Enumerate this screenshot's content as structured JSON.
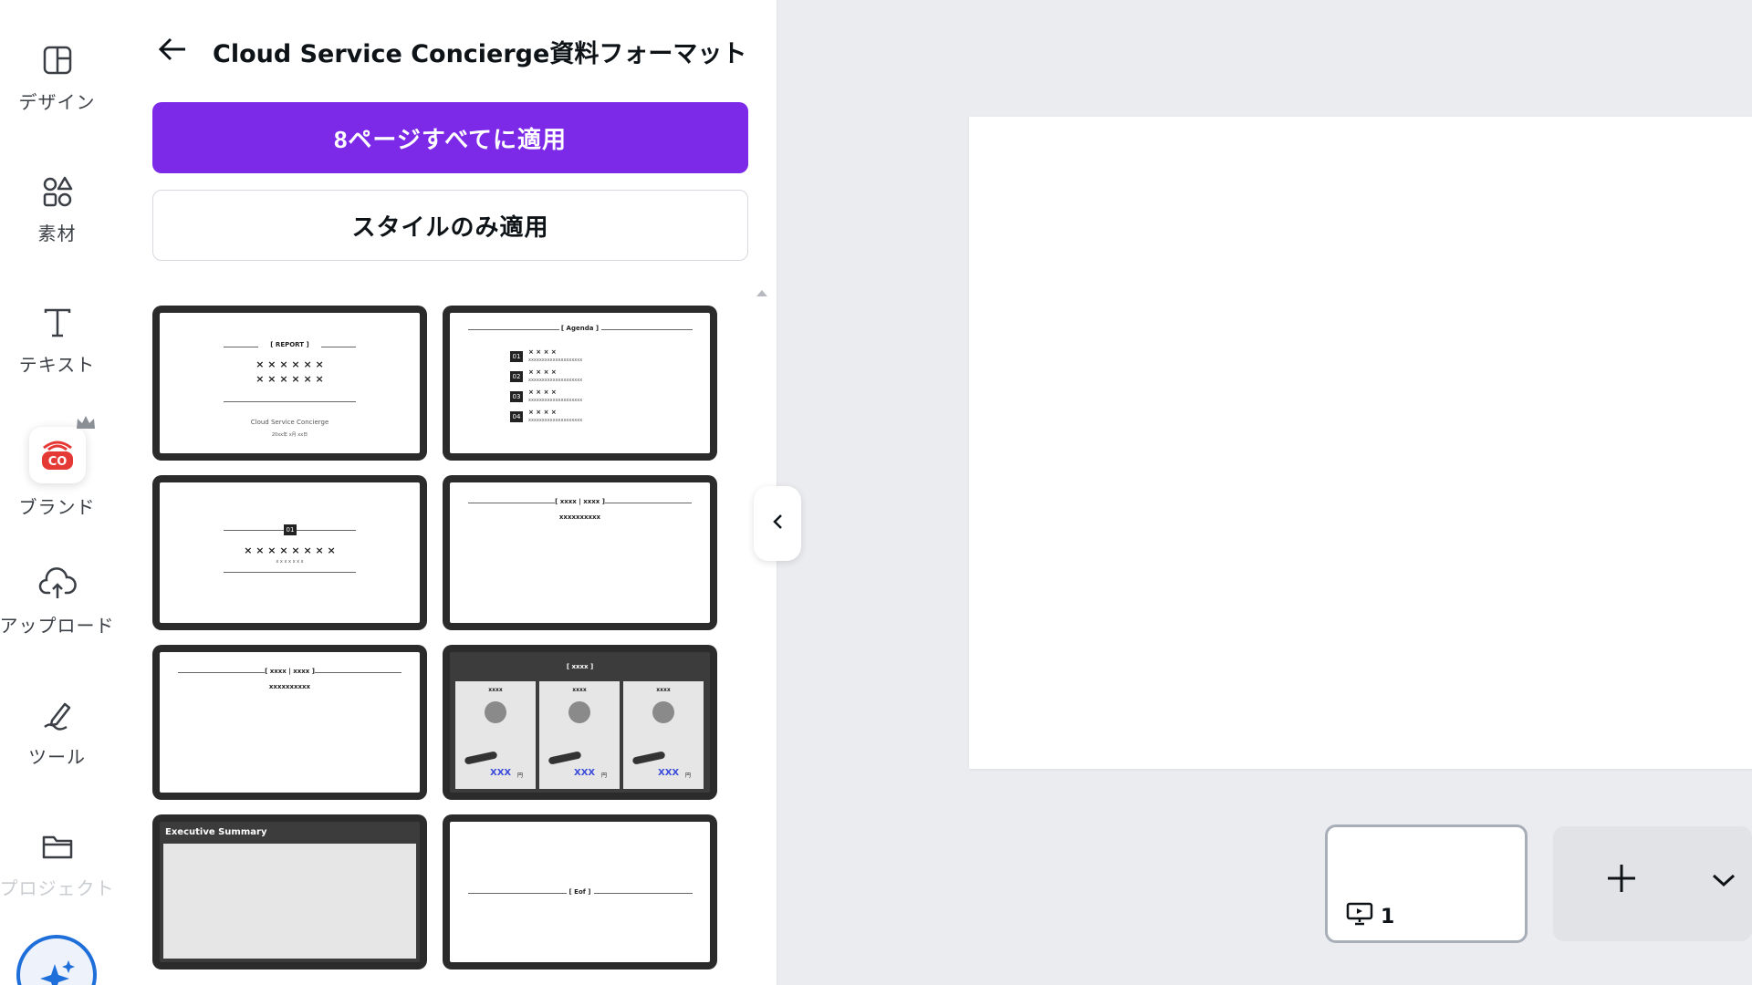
{
  "rail": {
    "items": [
      {
        "label": "デザイン",
        "icon": "layout-icon"
      },
      {
        "label": "素材",
        "icon": "shapes-icon"
      },
      {
        "label": "テキスト",
        "icon": "text-icon"
      },
      {
        "label": "ブランド",
        "icon": "brand-icon",
        "badge": "CO"
      },
      {
        "label": "アップロード",
        "icon": "cloud-upload-icon"
      },
      {
        "label": "ツール",
        "icon": "pen-tool-icon"
      },
      {
        "label": "プロジェクト",
        "icon": "folder-icon"
      }
    ]
  },
  "panel": {
    "title": "Cloud Service Concierge資料フォーマット",
    "apply_all": "8ページすべてに適用",
    "apply_style": "スタイルのみ適用",
    "thumbs": [
      {
        "heading": "[ REPORT ]",
        "line1": "× × × × × ×",
        "line2": "× × × × × ×",
        "logo": "Cloud Service Concierge",
        "date": "20xx年 x月 xx日"
      },
      {
        "heading": "[ Agenda ]",
        "items": [
          {
            "num": "01",
            "title": "× × × ×",
            "sub": "xxxxxxxxxxxxxxxxxxxx"
          },
          {
            "num": "02",
            "title": "× × × ×",
            "sub": "xxxxxxxxxxxxxxxxxxxx"
          },
          {
            "num": "03",
            "title": "× × × ×",
            "sub": "xxxxxxxxxxxxxxxxxxxx"
          },
          {
            "num": "04",
            "title": "× × × ×",
            "sub": "xxxxxxxxxxxxxxxxxxxx"
          }
        ]
      },
      {
        "num": "01",
        "title": "× × × × × × × ×",
        "sub": "x x x x x x x"
      },
      {
        "heading": "[ xxxx | xxxx ]",
        "sub": "xxxxxxxxxx"
      },
      {
        "heading": "[ xxxx | xxxx ]",
        "sub": "xxxxxxxxxx"
      },
      {
        "heading": "[ xxxx ]",
        "col_title": "xxxx",
        "col_value": "XXX",
        "col_unit": "円"
      },
      {
        "heading": "Executive Summary"
      },
      {
        "heading": "[ Eof ]"
      }
    ]
  },
  "pages": {
    "current": "1"
  },
  "colors": {
    "accent": "#7d2ae8",
    "brand_red": "#e53935",
    "magic_blue": "#1e6fd9"
  }
}
